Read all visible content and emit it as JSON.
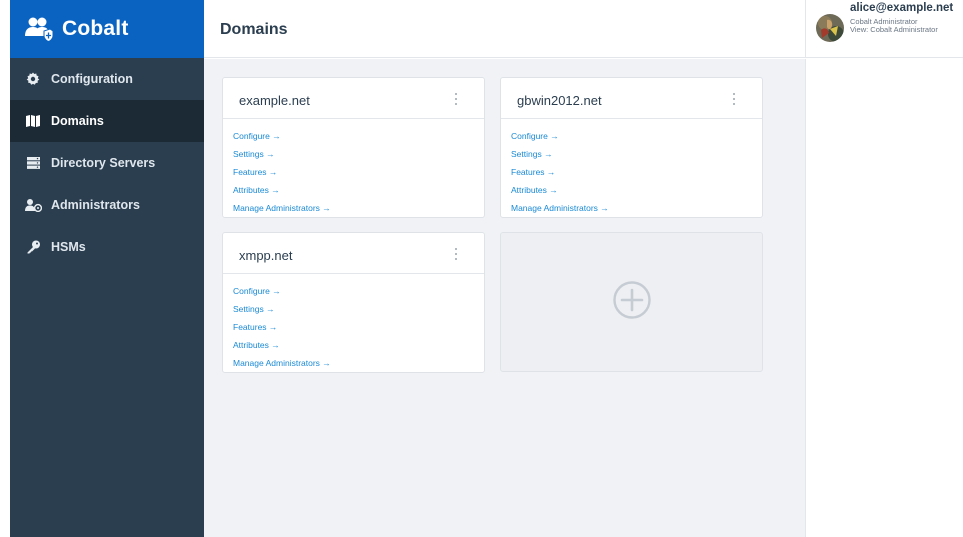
{
  "app": {
    "name": "Cobalt"
  },
  "sidebar": {
    "items": [
      {
        "label": "Configuration",
        "icon": "gear-icon",
        "active": false
      },
      {
        "label": "Domains",
        "icon": "map-icon",
        "active": true
      },
      {
        "label": "Directory Servers",
        "icon": "server-icon",
        "active": false
      },
      {
        "label": "Administrators",
        "icon": "admin-users-icon",
        "active": false
      },
      {
        "label": "HSMs",
        "icon": "key-icon",
        "active": false
      }
    ]
  },
  "header": {
    "title": "Domains",
    "user": {
      "email": "alice@example.net",
      "role": "Cobalt Administrator",
      "view": "View: Cobalt Administrator"
    }
  },
  "domains": [
    {
      "name": "example.net",
      "links": [
        "Configure →",
        "Settings →",
        "Features →",
        "Attributes →",
        "Manage Administrators →"
      ]
    },
    {
      "name": "gbwin2012.net",
      "links": [
        "Configure →",
        "Settings →",
        "Features →",
        "Attributes →",
        "Manage Administrators →"
      ]
    },
    {
      "name": "xmpp.net",
      "links": [
        "Configure →",
        "Settings →",
        "Features →",
        "Attributes →",
        "Manage Administrators →"
      ]
    }
  ],
  "add_card": {
    "icon": "plus-circle-icon"
  },
  "colors": {
    "brand": "#0b63c1",
    "sidebar": "#2b3e50",
    "sidebar_active": "#1c2a36",
    "link": "#1a8ad6",
    "background": "#f0f2f5"
  }
}
